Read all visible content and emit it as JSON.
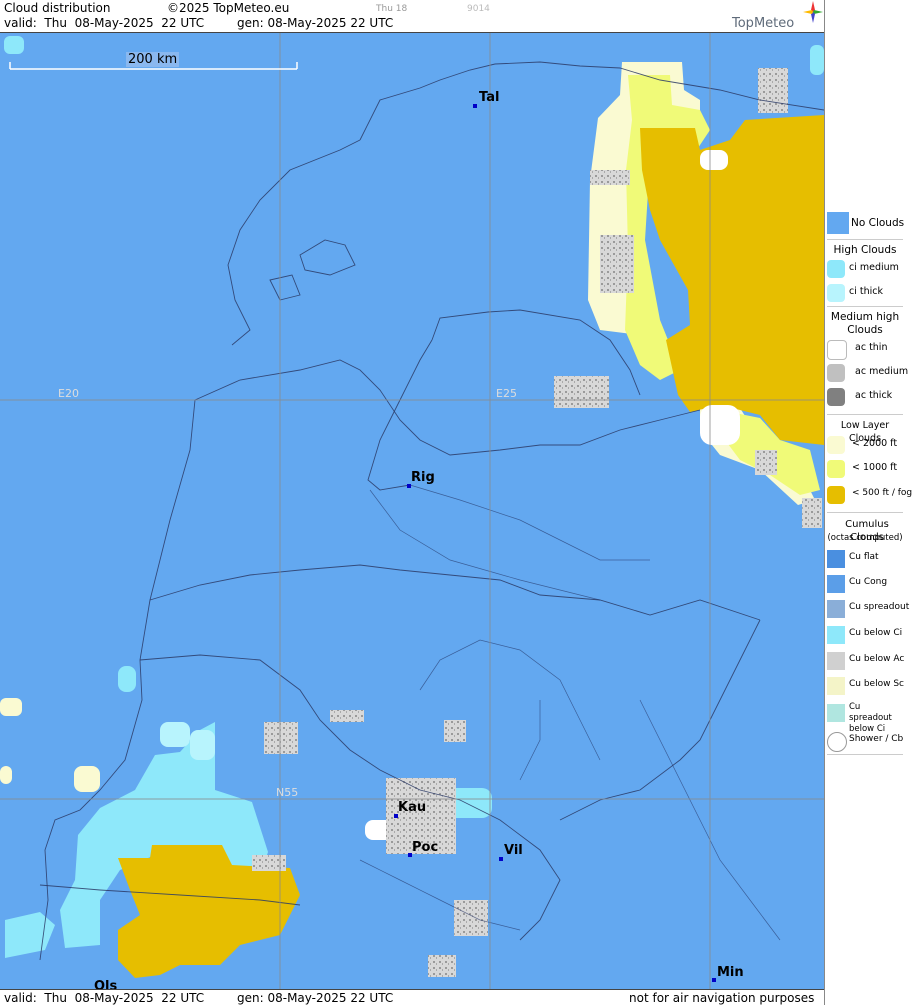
{
  "header": {
    "product": "Cloud distribution",
    "copyright": "©2025 TopMeteo.eu",
    "run_day": "Thu 18",
    "code": "9014",
    "valid": "valid:  Thu  08-May-2025  22 UTC",
    "gen": "gen: 08-May-2025 22 UTC",
    "brand": "TopMeteo"
  },
  "map": {
    "scale_label": "200 km",
    "grid_labels": {
      "e20": "E20",
      "e25": "E25",
      "n55": "N55"
    },
    "cities": {
      "tal": "Tal",
      "rig": "Rig",
      "kau": "Kau",
      "poc": "Poc",
      "vil": "Vil",
      "min": "Min",
      "ols": "Ols"
    }
  },
  "footer": {
    "valid": "valid:  Thu  08-May-2025  22 UTC",
    "gen": "gen: 08-May-2025 22 UTC",
    "disclaimer": "not for air navigation purposes"
  },
  "legend": {
    "no_clouds": "No Clouds",
    "high_title": "High Clouds",
    "ci_medium": "ci medium",
    "ci_thick": "ci thick",
    "medium_title": "Medium high Clouds",
    "ac_thin": "ac thin",
    "ac_medium": "ac medium",
    "ac_thick": "ac thick",
    "low_title": "Low Layer Clouds",
    "low_2000": "< 2000 ft",
    "low_1000": "< 1000 ft",
    "low_500": "< 500 ft / fog",
    "cu_title": "Cumulus Clouds",
    "cu_sub": "(octas computed)",
    "cu_flat": "Cu flat",
    "cu_cong": "Cu Cong",
    "cu_spreadout": "Cu spreadout",
    "cu_below_ci": "Cu below Ci",
    "cu_below_ac": "Cu below Ac",
    "cu_below_sc": "Cu below Sc",
    "cu_spread_ci": "Cu spreadout below Ci",
    "shower": "Shower / Cb"
  },
  "colors": {
    "no_clouds": "#63a8f0",
    "ci_medium": "#8ee8fa",
    "ci_thick": "#b8f4fd",
    "ac_thin": "#ffffff",
    "ac_medium": "#c0c0c0",
    "ac_thick": "#808080",
    "low_2000": "#fafad2",
    "low_1000": "#f0fa78",
    "low_500": "#e6be00"
  }
}
